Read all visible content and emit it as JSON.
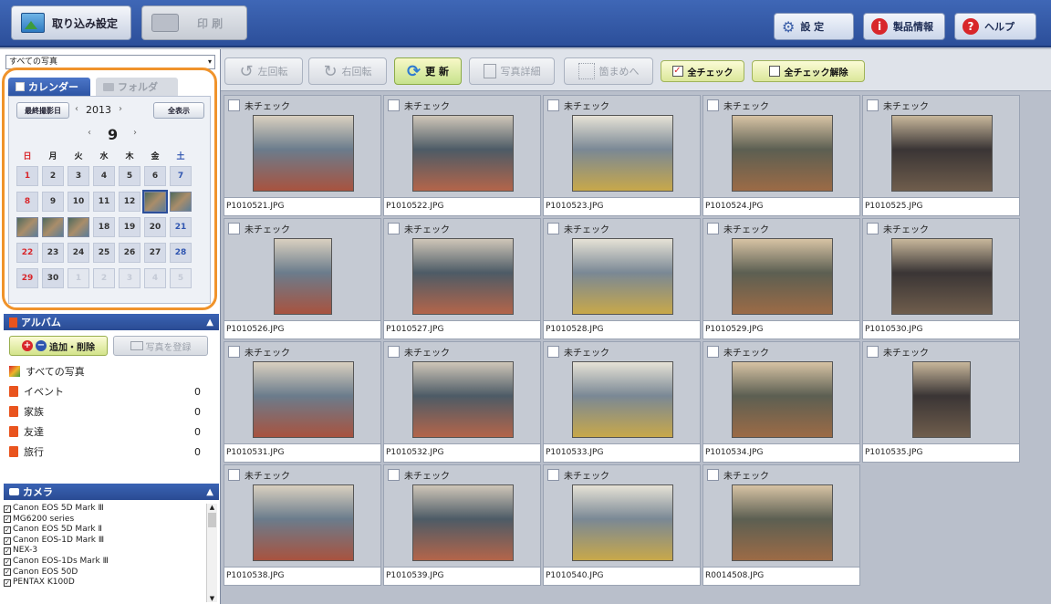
{
  "header": {
    "import_settings": "取り込み設定",
    "print": "印 刷",
    "settings": "設 定",
    "product_info": "製品情報",
    "help": "ヘルプ"
  },
  "left": {
    "source_select": "すべての写真",
    "tabs": {
      "calendar": "カレンダー",
      "folder": "フォルダ"
    },
    "calendar": {
      "latest_date_btn": "最終撮影日",
      "year": "2013",
      "show_all_btn": "全表示",
      "month": "9",
      "dow": [
        "日",
        "月",
        "火",
        "水",
        "木",
        "金",
        "土"
      ],
      "days": [
        "1",
        "2",
        "3",
        "4",
        "5",
        "6",
        "7",
        "8",
        "9",
        "10",
        "11",
        "12",
        "13",
        "14",
        "15",
        "16",
        "17",
        "18",
        "19",
        "20",
        "21",
        "22",
        "23",
        "24",
        "25",
        "26",
        "27",
        "28",
        "29",
        "30",
        "1",
        "2",
        "3",
        "4",
        "5"
      ],
      "photo_days": [
        "13",
        "14",
        "15",
        "16",
        "17"
      ],
      "selected_day": "13"
    },
    "album": {
      "title": "アルバム",
      "add_delete": "追加・削除",
      "register_photo": "写真を登録",
      "all_photos": "すべての写真",
      "items": [
        {
          "name": "イベント",
          "count": "0"
        },
        {
          "name": "家族",
          "count": "0"
        },
        {
          "name": "友達",
          "count": "0"
        },
        {
          "name": "旅行",
          "count": "0"
        }
      ]
    },
    "camera": {
      "title": "カメラ",
      "items": [
        "Canon EOS 5D Mark Ⅲ",
        "MG6200 series",
        "Canon EOS 5D Mark Ⅱ",
        "Canon EOS-1D Mark Ⅲ",
        "NEX-3",
        "Canon EOS-1Ds Mark Ⅲ",
        "Canon EOS 50D",
        "PENTAX K100D"
      ]
    }
  },
  "toolbar": {
    "rotate_left": "左回転",
    "rotate_right": "右回転",
    "refresh": "更 新",
    "photo_details": "写真詳細",
    "merge": "箇まめへ",
    "check_all": "全チェック",
    "uncheck_all": "全チェック解除"
  },
  "photos": {
    "check_label": "未チェック",
    "items": [
      {
        "file": "P1010521.JPG",
        "portrait": false
      },
      {
        "file": "P1010522.JPG",
        "portrait": false
      },
      {
        "file": "P1010523.JPG",
        "portrait": false
      },
      {
        "file": "P1010524.JPG",
        "portrait": false
      },
      {
        "file": "P1010525.JPG",
        "portrait": false
      },
      {
        "file": "P1010526.JPG",
        "portrait": true
      },
      {
        "file": "P1010527.JPG",
        "portrait": false
      },
      {
        "file": "P1010528.JPG",
        "portrait": false
      },
      {
        "file": "P1010529.JPG",
        "portrait": false
      },
      {
        "file": "P1010530.JPG",
        "portrait": false
      },
      {
        "file": "P1010531.JPG",
        "portrait": false
      },
      {
        "file": "P1010532.JPG",
        "portrait": false
      },
      {
        "file": "P1010533.JPG",
        "portrait": false
      },
      {
        "file": "P1010534.JPG",
        "portrait": false
      },
      {
        "file": "P1010535.JPG",
        "portrait": true
      },
      {
        "file": "P1010538.JPG",
        "portrait": false
      },
      {
        "file": "P1010539.JPG",
        "portrait": false
      },
      {
        "file": "P1010540.JPG",
        "portrait": false
      },
      {
        "file": "R0014508.JPG",
        "portrait": false
      }
    ]
  },
  "colors": {
    "header_blue": "#2c4f9a",
    "highlight_orange": "#f0932b",
    "sunday_red": "#d8262a",
    "saturday_blue": "#2f55b0"
  }
}
